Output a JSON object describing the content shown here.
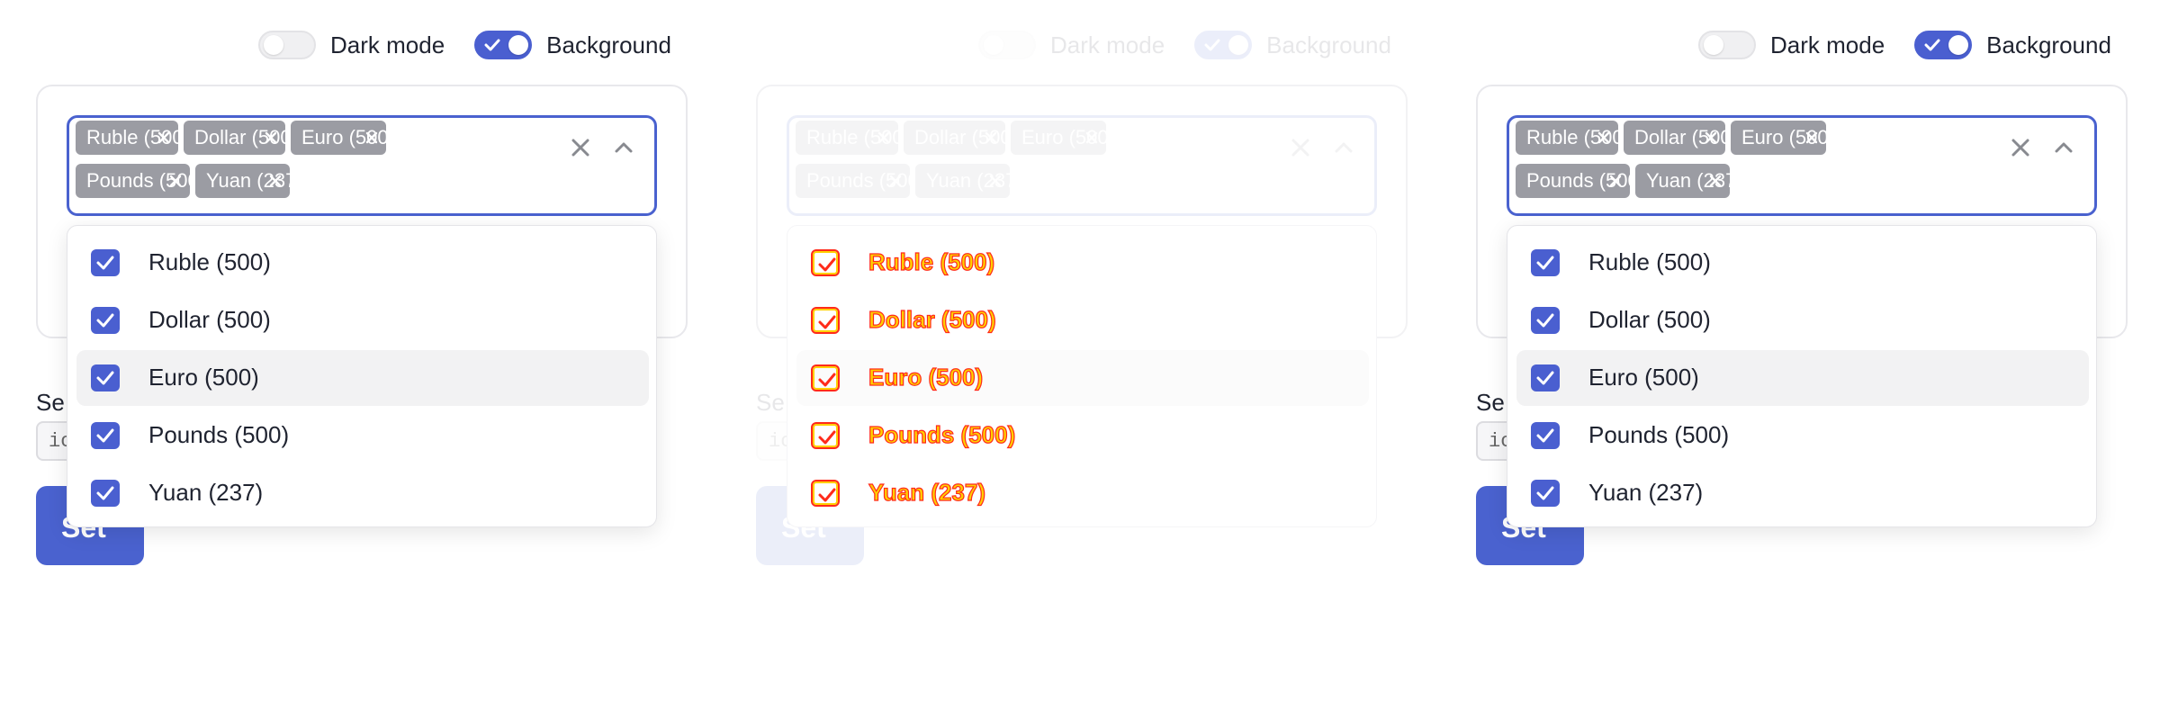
{
  "toggles": {
    "dark_mode_label": "Dark mode",
    "dark_mode_on": false,
    "background_label": "Background",
    "background_on": true
  },
  "select": {
    "chips": [
      "Ruble (500)",
      "Dollar (500)",
      "Euro (500)",
      "Pounds (500)",
      "Yuan (237)"
    ],
    "options": [
      "Ruble (500)",
      "Dollar (500)",
      "Euro (500)",
      "Pounds (500)",
      "Yuan (237)"
    ],
    "checked": [
      true,
      true,
      true,
      true,
      true
    ],
    "hovered_option": "Euro (500)",
    "clear_icon": "close-icon",
    "toggle_icon": "chevron-up-icon"
  },
  "form": {
    "set_label": "Se",
    "input_value": "ic",
    "set_button_label": "Set"
  },
  "colors": {
    "accent": "#4a62cf",
    "chip_bg": "#9b9ca3",
    "option_hover": "#f2f2f3"
  }
}
